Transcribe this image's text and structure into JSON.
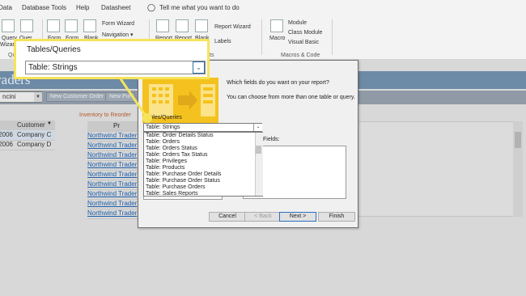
{
  "ribbon": {
    "tabs": [
      "Data",
      "Database Tools",
      "Help",
      "Datasheet"
    ],
    "tell_me": "Tell me what you want to do",
    "buttons": {
      "query": "Query",
      "wizard": "Wizard",
      "query_short": "Quer",
      "form": "Form",
      "form2": "Form",
      "blank": "Blank",
      "form_wizard": "Form Wizard",
      "navigation": "Navigation",
      "report": "Report",
      "report2": "Report",
      "blank2": "Blank",
      "report_wizard": "Report Wizard",
      "labels": "Labels",
      "macro": "Macro",
      "module": "Module",
      "class_module": "Class Module",
      "visual_basic": "Visual Basic"
    },
    "group_labels": {
      "queries": "Qu",
      "reports": "ts",
      "macros": "Macros & Code"
    }
  },
  "app": {
    "title": "raders",
    "combo_value": "ncini",
    "toolbar_buttons": [
      "New Customer Order",
      "New Pur"
    ]
  },
  "orders_grid": {
    "header": "Customer",
    "rows": [
      {
        "date": "2006",
        "customer": "Company C"
      },
      {
        "date": "2006",
        "customer": "Company D"
      }
    ]
  },
  "inventory": {
    "title": "Inventory to Reorder",
    "header": "Pr",
    "items": [
      "Northwind Trader",
      "Northwind Trader",
      "Northwind Trader",
      "Northwind Trader",
      "Northwind Trader",
      "Northwind Trader",
      "Northwind Trader",
      "Northwind Trader",
      "Northwind Trader"
    ]
  },
  "wizard": {
    "question": "Which fields do you want on your report?",
    "hint": "You can choose from more than one table or query.",
    "tables_label": "Tables/Queries",
    "selected_table": "Table: Strings",
    "list_items": [
      "Table: Order Details Status",
      "Table: Orders",
      "Table: Orders Status",
      "Table: Orders Tax Status",
      "Table: Privileges",
      "Table: Products",
      "Table: Purchase Order Details",
      "Table: Purchase Order Status",
      "Table: Purchase Orders",
      "Table: Sales Reports"
    ],
    "selected_fields_label": "Fields:",
    "buttons": {
      "cancel": "Cancel",
      "back": "< Back",
      "next": "Next >",
      "finish": "Finish"
    }
  },
  "callout": {
    "label": "Tables/Queries",
    "value": "Table: Strings"
  },
  "colors": {
    "callout": "#f5e45a",
    "title_band": "#6d8aa6",
    "link": "#1f5fa9"
  }
}
